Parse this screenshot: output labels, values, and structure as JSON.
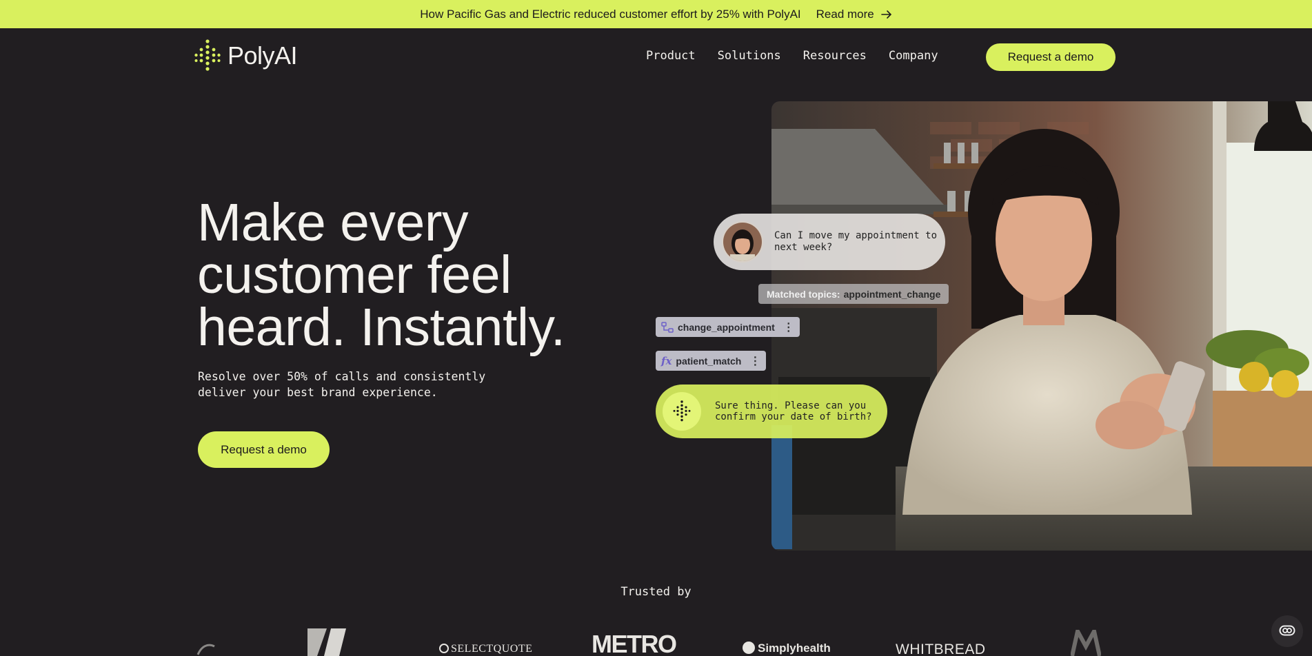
{
  "banner": {
    "text": "How Pacific Gas and Electric reduced customer effort by 25% with PolyAI",
    "link": "Read more"
  },
  "nav": {
    "logo": "PolyAI",
    "items": [
      "Product",
      "Solutions",
      "Resources",
      "Company"
    ],
    "cta": "Request a demo"
  },
  "hero": {
    "title_lines": [
      "Make every",
      "customer feel",
      "heard. Instantly."
    ],
    "subtitle_lines": [
      "Resolve over 50% of calls and consistently",
      "deliver your best brand experience."
    ],
    "cta": "Request a demo"
  },
  "demo": {
    "user_message": "Can I move my appointment to next week?",
    "topics_label": "Matched topics:",
    "topics_value": "appointment_change",
    "chips": [
      "change_appointment",
      "patient_match"
    ],
    "ai_message": "Sure thing. Please can you confirm your date of birth?"
  },
  "trusted": {
    "label": "Trusted by",
    "brands": [
      "SELECTQUOTE",
      "METRO",
      "Simplyhealth",
      "WHITBREAD"
    ]
  },
  "colors": {
    "accent": "#d9f05e",
    "background": "#211e21"
  },
  "icons": {
    "banner_arrow": "arrow-right-icon",
    "chat": "chat-bubble-icon"
  }
}
